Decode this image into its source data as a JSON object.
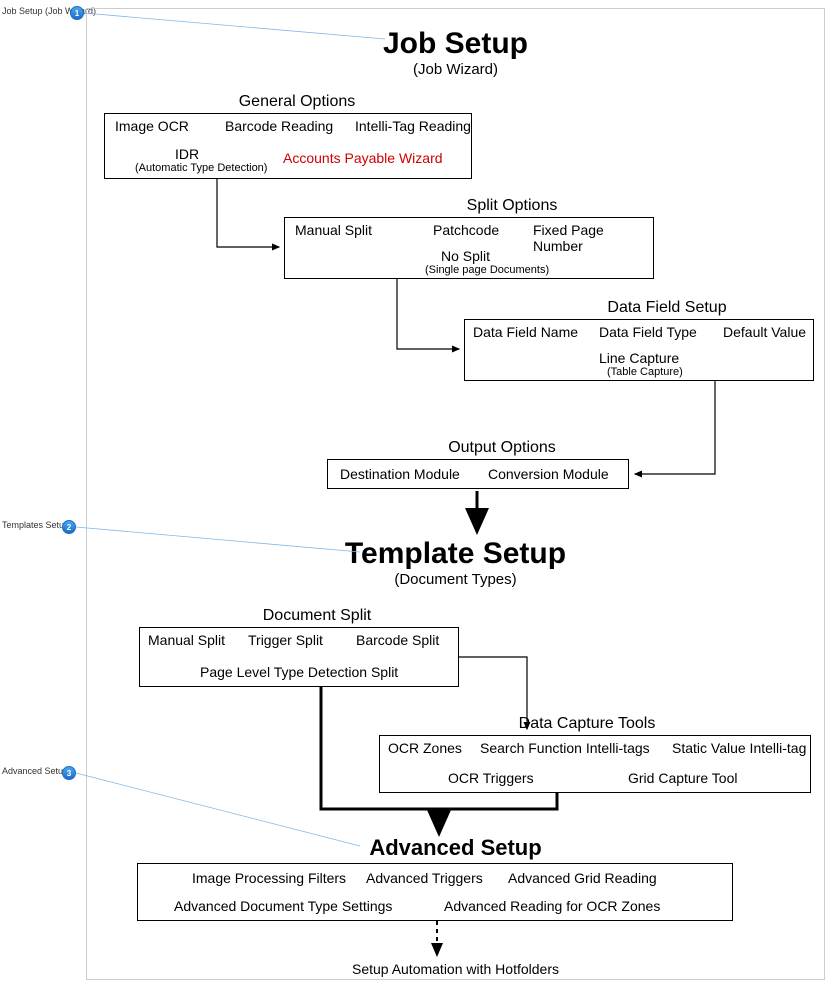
{
  "callouts": {
    "c1": {
      "label": "Job Setup (Job Wizard)",
      "num": "1"
    },
    "c2": {
      "label": "Templates Setup",
      "num": "2"
    },
    "c3": {
      "label": "Advanced Setup",
      "num": "3"
    }
  },
  "jobSetup": {
    "title": "Job Setup",
    "subtitle": "(Job Wizard)"
  },
  "generalOptions": {
    "label": "General Options",
    "items": {
      "imageOCR": "Image OCR",
      "barcodeReading": "Barcode Reading",
      "intelliTag": "Intelli-Tag Reading",
      "idr": "IDR",
      "idrSub": "(Automatic Type Detection)",
      "apWizard": "Accounts Payable Wizard"
    }
  },
  "splitOptions": {
    "label": "Split Options",
    "items": {
      "manualSplit": "Manual Split",
      "patchcode": "Patchcode",
      "fixedPage": "Fixed Page Number",
      "noSplit": "No Split",
      "noSplitSub": "(Single page Documents)"
    }
  },
  "dataFieldSetup": {
    "label": "Data Field Setup",
    "items": {
      "name": "Data Field Name",
      "type": "Data Field Type",
      "default": "Default Value",
      "lineCapture": "Line Capture",
      "lineCaptureSub": "(Table Capture)"
    }
  },
  "outputOptions": {
    "label": "Output Options",
    "items": {
      "destination": "Destination Module",
      "conversion": "Conversion Module"
    }
  },
  "templateSetup": {
    "title": "Template Setup",
    "subtitle": "(Document Types)"
  },
  "documentSplit": {
    "label": "Document Split",
    "items": {
      "manual": "Manual Split",
      "trigger": "Trigger Split",
      "barcode": "Barcode Split",
      "pageLevel": "Page Level Type Detection Split"
    }
  },
  "dataCaptureTools": {
    "label": "Data Capture Tools",
    "items": {
      "ocrZones": "OCR Zones",
      "searchFn": "Search Function Intelli-tags",
      "staticVal": "Static Value Intelli-tag",
      "ocrTriggers": "OCR Triggers",
      "gridCapture": "Grid Capture Tool"
    }
  },
  "advancedSetup": {
    "title": "Advanced Setup",
    "items": {
      "imgProc": "Image Processing Filters",
      "advTriggers": "Advanced Triggers",
      "advGrid": "Advanced Grid Reading",
      "advDocType": "Advanced Document Type Settings",
      "advOcrZones": "Advanced Reading for OCR Zones"
    }
  },
  "footer": "Setup Automation with Hotfolders"
}
